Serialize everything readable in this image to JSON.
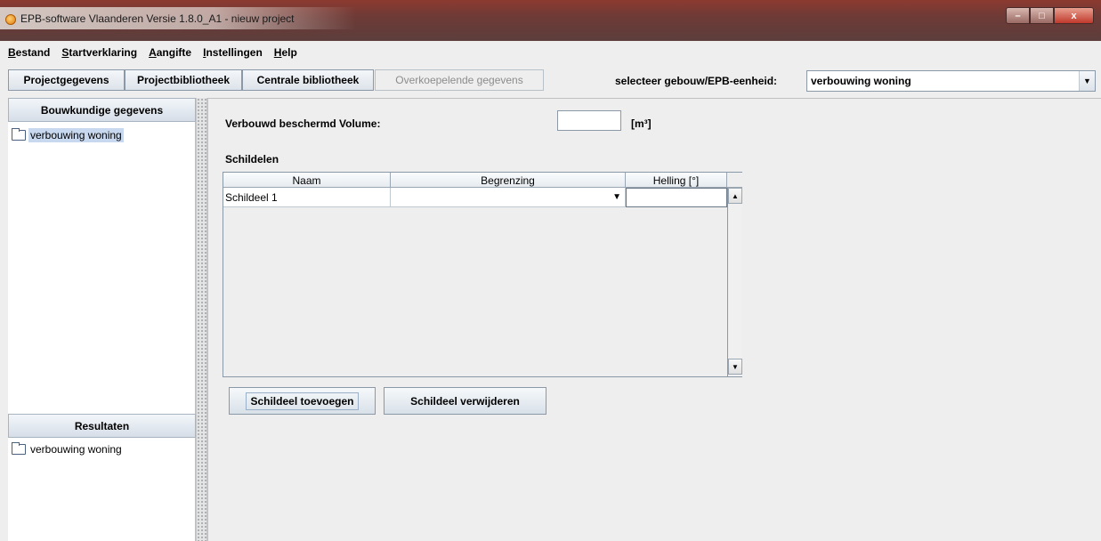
{
  "window": {
    "title": "EPB-software Vlaanderen Versie 1.8.0_A1 - nieuw project",
    "buttons": {
      "minimize": "–",
      "maximize": "□",
      "close": "x"
    }
  },
  "menu": [
    {
      "underline": "B",
      "rest": "estand"
    },
    {
      "underline": "S",
      "rest": "tartverklaring"
    },
    {
      "underline": "A",
      "rest": "angifte"
    },
    {
      "underline": "I",
      "rest": "nstellingen"
    },
    {
      "underline": "H",
      "rest": "elp"
    }
  ],
  "toolbar": {
    "tabs": [
      "Projectgegevens",
      "Projectbibliotheek",
      "Centrale bibliotheek",
      "Overkoepelende gegevens"
    ],
    "select_label": "selecteer gebouw/EPB-eenheid:",
    "select_value": "verbouwing woning"
  },
  "left": {
    "bouwkundig_header": "Bouwkundige gegevens",
    "bouwkundig_item": "verbouwing woning",
    "resultaten_header": "Resultaten",
    "resultaten_item": "verbouwing woning"
  },
  "main": {
    "volume_label": "Verbouwd beschermd Volume:",
    "volume_value": "",
    "volume_unit": "[m³]",
    "schildelen_label": "Schildelen",
    "table": {
      "columns": [
        "Naam",
        "Begrenzing",
        "Helling [°]"
      ],
      "rows": [
        {
          "naam": "Schildeel 1",
          "begrenzing": "",
          "helling": ""
        }
      ]
    },
    "add_button": "Schildeel toevoegen",
    "remove_button": "Schildeel verwijderen"
  },
  "colors": {
    "selection": "#c8d8ee",
    "titlebar": "#6e3a36"
  }
}
